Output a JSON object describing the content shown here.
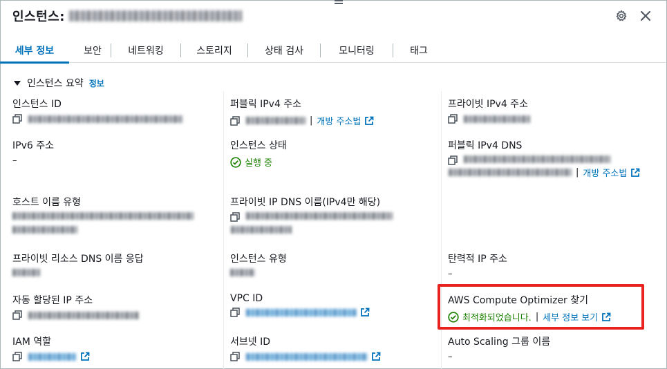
{
  "header": {
    "title": "인스턴스:",
    "settings_icon": "gear-icon",
    "close_icon": "close-icon"
  },
  "tabs": [
    {
      "label": "세부 정보",
      "active": true
    },
    {
      "label": "보안"
    },
    {
      "label": "네트워킹"
    },
    {
      "label": "스토리지"
    },
    {
      "label": "상태 검사"
    },
    {
      "label": "모니터링"
    },
    {
      "label": "태그"
    }
  ],
  "summary": {
    "title": "인스턴스 요약",
    "info_link": "정보"
  },
  "fields": {
    "instance_id": {
      "label": "인스턴스 ID"
    },
    "public_ipv4": {
      "label": "퍼블릭 IPv4 주소",
      "link": "개방 주소법"
    },
    "private_ipv4": {
      "label": "프라이빗 IPv4 주소"
    },
    "ipv6": {
      "label": "IPv6 주소",
      "value": "–"
    },
    "instance_state": {
      "label": "인스턴스 상태",
      "value": "실행 중"
    },
    "public_ipv4_dns": {
      "label": "퍼블릭 IPv4 DNS",
      "link": "개방 주소법"
    },
    "hostname_type": {
      "label": "호스트 이름 유형"
    },
    "private_ip_dns": {
      "label": "프라이빗 IP DNS 이름(IPv4만 해당)"
    },
    "private_resource_dns": {
      "label": "프라이빗 리소스 DNS 이름 응답"
    },
    "instance_type": {
      "label": "인스턴스 유형"
    },
    "elastic_ip": {
      "label": "탄력적 IP 주소",
      "value": "–"
    },
    "auto_assigned_ip": {
      "label": "자동 할당된 IP 주소"
    },
    "vpc_id": {
      "label": "VPC ID"
    },
    "compute_optimizer": {
      "label": "AWS Compute Optimizer 찾기",
      "status": "최적화되었습니다.",
      "link": "세부 정보 보기"
    },
    "iam_role": {
      "label": "IAM 역할"
    },
    "subnet_id": {
      "label": "서브넷 ID"
    },
    "auto_scaling": {
      "label": "Auto Scaling 그룹 이름",
      "value": "–"
    }
  },
  "colors": {
    "link": "#0073bb",
    "success": "#1d8102",
    "highlight": "#e8231f"
  }
}
